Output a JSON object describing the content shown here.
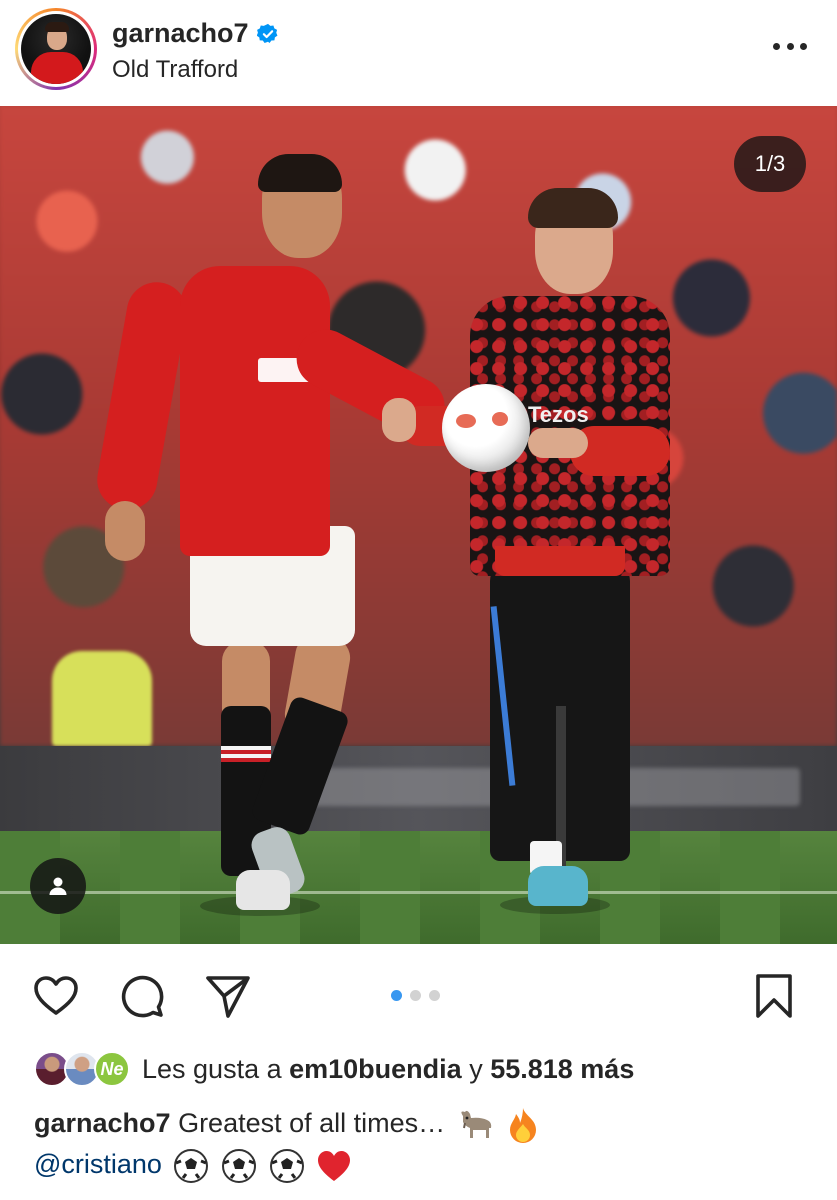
{
  "header": {
    "username": "garnacho7",
    "verified": true,
    "location": "Old Trafford",
    "more_icon": "more-horizontal-icon"
  },
  "media": {
    "counter": "1/3",
    "current_index": 1,
    "total": 3,
    "tag_icon": "user-tag-icon",
    "sponsor_text": "Tezos"
  },
  "actions": {
    "like_icon": "heart-icon",
    "comment_icon": "comment-icon",
    "share_icon": "send-icon",
    "save_icon": "bookmark-icon"
  },
  "likes": {
    "prefix": "Les gusta a",
    "user": "em10buendia",
    "joiner": "y",
    "count": "55.818 más",
    "avatar_badge": "Ne"
  },
  "caption": {
    "user": "garnacho7",
    "text": "Greatest of all times…",
    "mention": "@cristiano",
    "emojis": [
      "goat-emoji",
      "fire-emoji",
      "soccer-ball-emoji",
      "soccer-ball-emoji",
      "soccer-ball-emoji",
      "red-heart-emoji"
    ]
  },
  "colors": {
    "link": "#00376b",
    "verified": "#0095f6",
    "dot_active": "#3897f0",
    "text": "#262626"
  }
}
